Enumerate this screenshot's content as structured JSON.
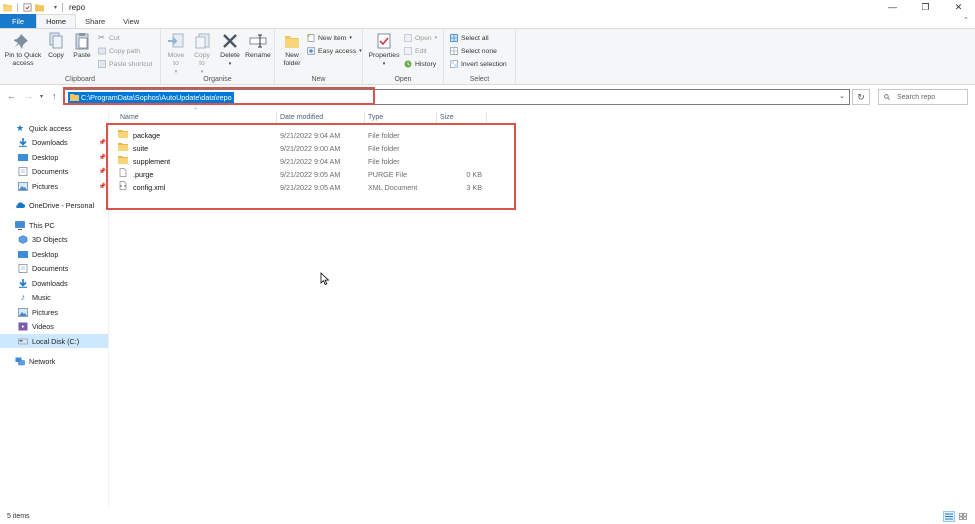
{
  "window": {
    "title": "repo",
    "controls": {
      "minimize": "—",
      "maximize": "❐",
      "close": "✕"
    }
  },
  "ribbon_tabs": {
    "file": "File",
    "home": "Home",
    "share": "Share",
    "view": "View"
  },
  "ribbon": {
    "clipboard": {
      "label": "Clipboard",
      "pin": "Pin to Quick access",
      "copy": "Copy",
      "paste": "Paste",
      "cut": "Cut",
      "copy_path": "Copy path",
      "paste_shortcut": "Paste shortcut"
    },
    "organise": {
      "label": "Organise",
      "move_to": "Move to",
      "copy_to": "Copy to",
      "delete": "Delete",
      "rename": "Rename"
    },
    "new": {
      "label": "New",
      "new_folder": "New folder",
      "new_item": "New item",
      "easy_access": "Easy access"
    },
    "open": {
      "label": "Open",
      "properties": "Properties",
      "open": "Open",
      "edit": "Edit",
      "history": "History"
    },
    "select": {
      "label": "Select",
      "select_all": "Select all",
      "select_none": "Select none",
      "invert_selection": "Invert selection"
    }
  },
  "address_bar": {
    "path": "C:\\ProgramData\\Sophos\\AutoUpdate\\data\\repo",
    "search_placeholder": "Search repo"
  },
  "nav_pane": {
    "quick_access": "Quick access",
    "quick_items": [
      {
        "label": "Downloads",
        "icon": "download-arrow-icon"
      },
      {
        "label": "Desktop",
        "icon": "desktop-icon"
      },
      {
        "label": "Documents",
        "icon": "documents-icon"
      },
      {
        "label": "Pictures",
        "icon": "pictures-icon"
      }
    ],
    "onedrive": "OneDrive - Personal",
    "this_pc": "This PC",
    "pc_items": [
      {
        "label": "3D Objects",
        "icon": "3d-objects-icon"
      },
      {
        "label": "Desktop",
        "icon": "desktop-icon"
      },
      {
        "label": "Documents",
        "icon": "documents-icon"
      },
      {
        "label": "Downloads",
        "icon": "download-arrow-icon"
      },
      {
        "label": "Music",
        "icon": "music-icon"
      },
      {
        "label": "Pictures",
        "icon": "pictures-icon"
      },
      {
        "label": "Videos",
        "icon": "videos-icon"
      },
      {
        "label": "Local Disk (C:)",
        "icon": "drive-icon"
      }
    ],
    "network": "Network"
  },
  "file_list": {
    "columns": {
      "name": "Name",
      "date": "Date modified",
      "type": "Type",
      "size": "Size"
    },
    "rows": [
      {
        "name": "package",
        "date": "9/21/2022 9:04 AM",
        "type": "File folder",
        "size": "",
        "icon": "folder-icon"
      },
      {
        "name": "suite",
        "date": "9/21/2022 9:00 AM",
        "type": "File folder",
        "size": "",
        "icon": "folder-icon"
      },
      {
        "name": "supplement",
        "date": "9/21/2022 9:04 AM",
        "type": "File folder",
        "size": "",
        "icon": "folder-icon"
      },
      {
        "name": ".purge",
        "date": "9/21/2022 9:05 AM",
        "type": "PURGE File",
        "size": "0 KB",
        "icon": "file-icon"
      },
      {
        "name": "config.xml",
        "date": "9/21/2022 9:05 AM",
        "type": "XML Document",
        "size": "3 KB",
        "icon": "xml-file-icon"
      }
    ]
  },
  "status_bar": {
    "item_count": "5 items"
  },
  "colors": {
    "accent": "#1979ca",
    "selection": "#0078d7",
    "annotation": "#d9534f",
    "folder": "#f2c55c",
    "nav_selected": "#cce8ff"
  }
}
